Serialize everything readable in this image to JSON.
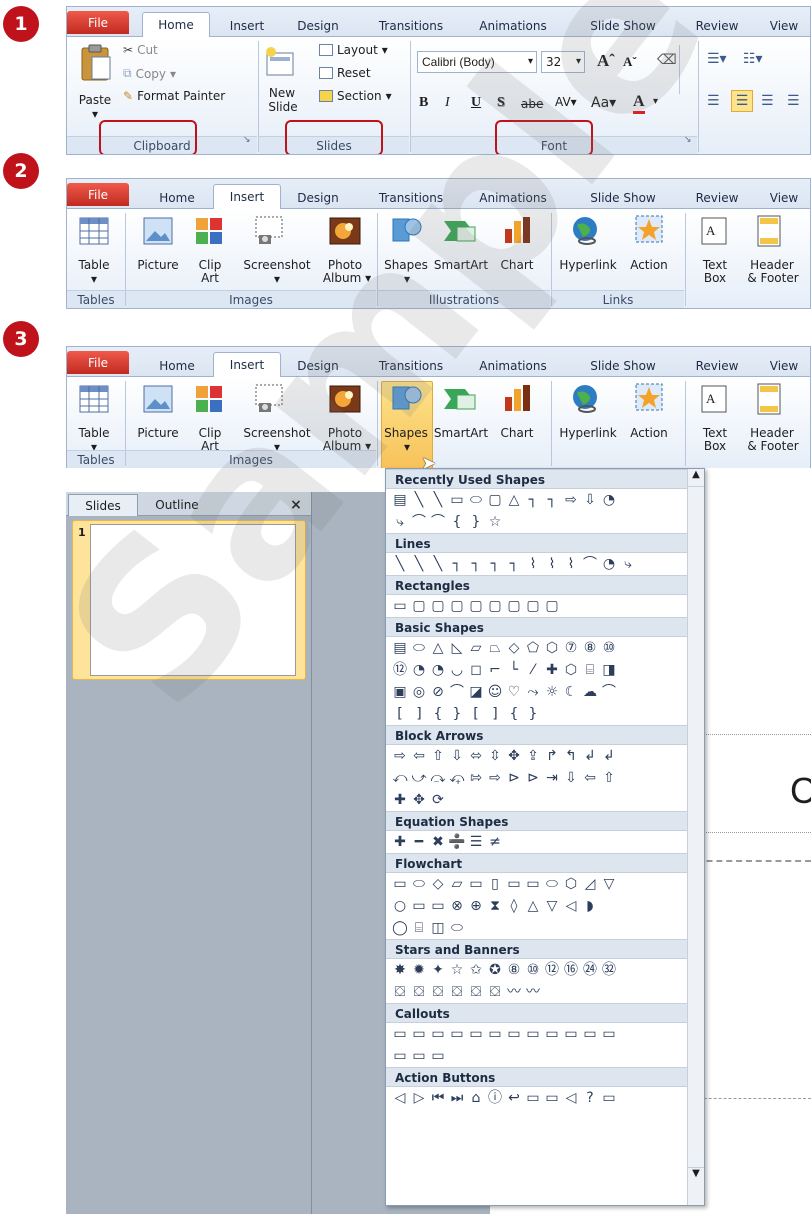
{
  "steps": [
    "1",
    "2",
    "3"
  ],
  "ribbon1": {
    "tabs": [
      "File",
      "Home",
      "Insert",
      "Design",
      "Transitions",
      "Animations",
      "Slide Show",
      "Review",
      "View"
    ],
    "clipboard": {
      "paste": "Paste",
      "cut": "Cut",
      "copy": "Copy",
      "format_painter": "Format Painter",
      "group": "Clipboard"
    },
    "slides": {
      "new_slide_1": "New",
      "new_slide_2": "Slide",
      "layout": "Layout",
      "reset": "Reset",
      "section": "Section",
      "group": "Slides"
    },
    "font": {
      "name": "Calibri (Body)",
      "size": "32",
      "group": "Font",
      "bold": "B",
      "italic": "I",
      "underline": "U",
      "shadow": "S",
      "strike": "abe",
      "spacing": "AV",
      "case": "Aa",
      "color": "A"
    }
  },
  "ribbon2": {
    "tabs": [
      "File",
      "Home",
      "Insert",
      "Design",
      "Transitions",
      "Animations",
      "Slide Show",
      "Review",
      "View"
    ],
    "buttons": {
      "table": "Table",
      "picture": "Picture",
      "clip_1": "Clip",
      "clip_2": "Art",
      "screenshot": "Screenshot",
      "photo_1": "Photo",
      "photo_2": "Album",
      "shapes": "Shapes",
      "smartart": "SmartArt",
      "chart": "Chart",
      "hyperlink": "Hyperlink",
      "action": "Action",
      "text_1": "Text",
      "text_2": "Box",
      "header_1": "Header",
      "header_2": "& Footer"
    },
    "groups": {
      "tables": "Tables",
      "images": "Images",
      "illustrations": "Illustrations",
      "links": "Links"
    }
  },
  "ribbon3": {
    "tabs": [
      "File",
      "Home",
      "Insert",
      "Design",
      "Transitions",
      "Animations",
      "Slide Show",
      "Review",
      "View"
    ],
    "groups": {
      "tables": "Tables",
      "images": "Images"
    }
  },
  "pane": {
    "tab_slides": "Slides",
    "tab_outline": "Outline",
    "close": "×",
    "slide_number": "1",
    "slide_letter": "C"
  },
  "shapes_menu": {
    "sections": [
      {
        "title": "Recently Used Shapes",
        "rows": [
          "▤╲╲▭⬭▢△┐┐⇨⇩◔",
          "⤷⌒⌒{}☆"
        ]
      },
      {
        "title": "Lines",
        "rows": [
          "╲╲╲┐┐┐┐⌇⌇⌇⌒◔⤷"
        ]
      },
      {
        "title": "Rectangles",
        "rows": [
          "▭▢▢▢▢▢▢▢▢"
        ]
      },
      {
        "title": "Basic Shapes",
        "rows": [
          "▤⬭△◺▱⏢◇⬠⬡⑦⑧⑩",
          "⑫◔◔◡◻⌐└⁄✚⬡⌸◨",
          "▣◎⊘⌒◪☺♡⤳☼☾☁⌒",
          "[]{}[]{}"
        ]
      },
      {
        "title": "Block Arrows",
        "rows": [
          "⇨⇦⇧⇩⬄⇳✥⇪↱↰↲↲",
          "⤺⤻⤼⤽⇰⇨⊳⊳⇥⇩⇦⇧",
          "✚✥⟳"
        ]
      },
      {
        "title": "Equation Shapes",
        "rows": [
          "✚━✖➗☰≠"
        ]
      },
      {
        "title": "Flowchart",
        "rows": [
          "▭⬭◇▱▭▯▭▭⬭⬡◿▽",
          "○▭▭⊗⊕⧗◊△▽◁◗",
          "◯⌸◫⬭"
        ]
      },
      {
        "title": "Stars and Banners",
        "rows": [
          "✸✹✦☆✩✪⑧⑩⑫⑯㉔㉜",
          "⛋⛋⛋⛋⛋⛋〰〰"
        ]
      },
      {
        "title": "Callouts",
        "rows": [
          "▭▭▭▭▭▭▭▭▭▭▭▭",
          "▭▭▭"
        ]
      },
      {
        "title": "Action Buttons",
        "rows": [
          "◁▷⏮⏭⌂ⓘ↩▭▭◁?▭"
        ]
      }
    ]
  }
}
